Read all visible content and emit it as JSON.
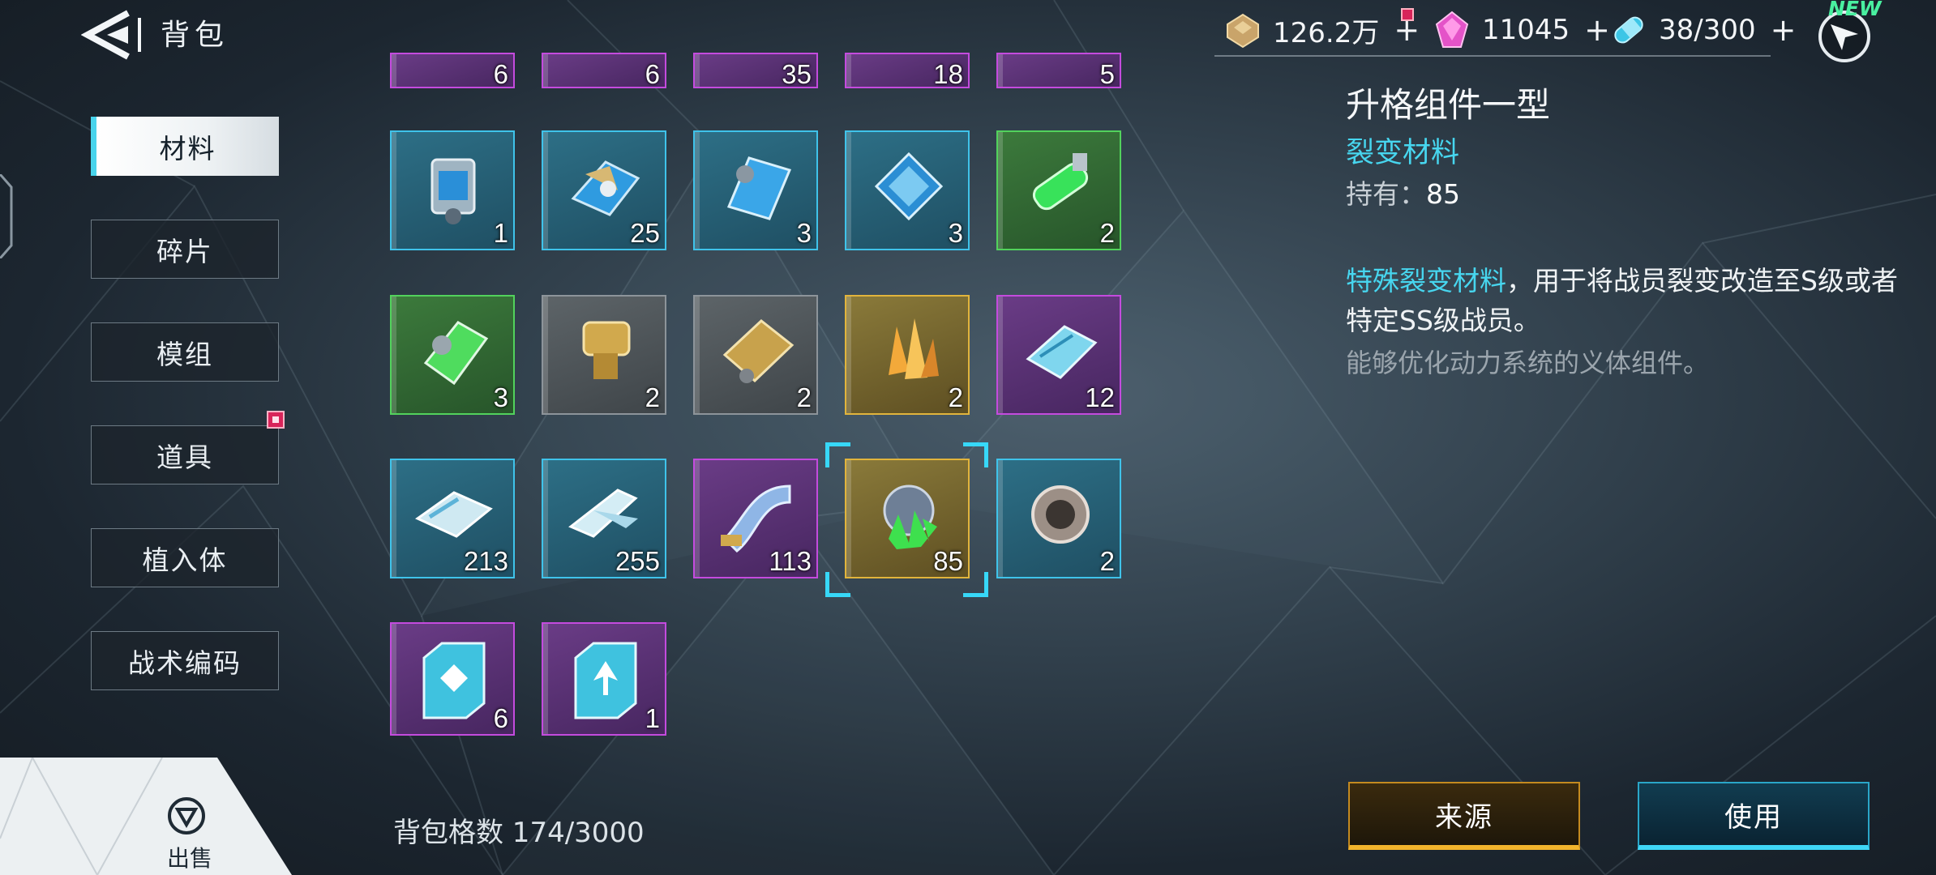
{
  "header": {
    "title": "背包"
  },
  "nav": {
    "items": [
      {
        "label": "材料",
        "active": true
      },
      {
        "label": "碎片"
      },
      {
        "label": "模组"
      },
      {
        "label": "道具",
        "badge": true
      },
      {
        "label": "植入体"
      },
      {
        "label": "战术编码"
      }
    ]
  },
  "currency": {
    "gold": {
      "value": "126.2万",
      "plus": "+"
    },
    "gem": {
      "value": "11045",
      "plus": "+"
    },
    "stamina": {
      "value": "38/300",
      "plus": "+"
    },
    "new_tag": "NEW"
  },
  "grid": {
    "partial_row": [
      "6",
      "6",
      "35",
      "18",
      "5"
    ],
    "rows": [
      [
        {
          "qty": "1",
          "rarity": "blue",
          "icon": "blue-module-icon"
        },
        {
          "qty": "25",
          "rarity": "blue",
          "icon": "blue-wing-icon"
        },
        {
          "qty": "3",
          "rarity": "blue",
          "icon": "blue-shard-icon"
        },
        {
          "qty": "3",
          "rarity": "blue",
          "icon": "blue-crystal-icon"
        },
        {
          "qty": "2",
          "rarity": "green",
          "icon": "green-capsule-icon"
        }
      ],
      [
        {
          "qty": "3",
          "rarity": "green",
          "icon": "green-plate-icon"
        },
        {
          "qty": "2",
          "rarity": "gray",
          "icon": "brass-coupler-icon"
        },
        {
          "qty": "2",
          "rarity": "gray",
          "icon": "mesh-plate-icon"
        },
        {
          "qty": "2",
          "rarity": "gold",
          "icon": "amber-crystal-icon"
        },
        {
          "qty": "12",
          "rarity": "purple",
          "icon": "circuit-block-icon"
        }
      ],
      [
        {
          "qty": "213",
          "rarity": "blue",
          "icon": "chip-block-icon"
        },
        {
          "qty": "255",
          "rarity": "blue",
          "icon": "chip-fork-icon"
        },
        {
          "qty": "113",
          "rarity": "purple",
          "icon": "ribbon-cable-icon"
        },
        {
          "qty": "85",
          "rarity": "gold",
          "icon": "green-core-icon",
          "selected": true
        },
        {
          "qty": "2",
          "rarity": "blue",
          "icon": "turbine-ring-icon"
        }
      ],
      [
        {
          "qty": "6",
          "rarity": "purple",
          "icon": "code-card-icon"
        },
        {
          "qty": "1",
          "rarity": "purple",
          "icon": "code-card-arrow-icon"
        }
      ]
    ]
  },
  "footer": {
    "bag_capacity": "背包格数 174/3000",
    "sell_label": "出售"
  },
  "detail": {
    "title": "升格组件一型",
    "type": "裂变材料",
    "own_label": "持有：",
    "own_value": "85",
    "desc_highlight": "特殊裂变材料",
    "desc_rest_1": "，用于将战员裂变改造至S级或者",
    "desc_line_2": "特定SS级战员。",
    "flavor": "能够优化动力系统的义体组件。",
    "buttons": {
      "source": "来源",
      "use": "使用"
    }
  },
  "colors": {
    "accent_cyan": "#47d6ef",
    "rarity_blue": "#3fc3ea",
    "rarity_green": "#52d25c",
    "rarity_gray": "#8d949a",
    "rarity_gold": "#e1b43c",
    "rarity_purple": "#c44bde",
    "badge_red": "#d8245a"
  }
}
